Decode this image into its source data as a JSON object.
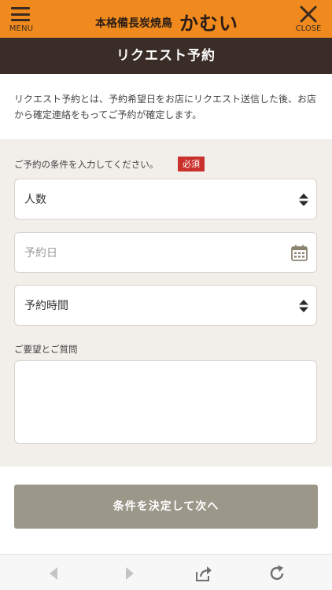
{
  "header": {
    "menu_label": "MENU",
    "close_label": "CLOSE",
    "brand_sub": "本格備長炭焼鳥",
    "brand_main": "かむい",
    "accent_color": "#f08a1e"
  },
  "page": {
    "title": "リクエスト予約",
    "intro": "リクエスト予約とは、予約希望日をお店にリクエスト送信した後、お店から確定連絡をもってご予約が確定します。"
  },
  "form": {
    "conditions_label": "ご予約の条件を入力してください。",
    "required_badge": "必須",
    "people_select": {
      "value": "人数",
      "icon": "sort-arrows-icon"
    },
    "date_input": {
      "placeholder": "予約日",
      "icon": "calendar-icon"
    },
    "time_select": {
      "value": "予約時間",
      "icon": "sort-arrows-icon"
    },
    "notes_label": "ご要望とご質問",
    "notes_value": "",
    "submit_label": "条件を決定して次へ"
  },
  "browser_toolbar": {
    "icons": [
      "back-arrow-icon",
      "forward-arrow-icon",
      "share-icon",
      "reload-icon"
    ]
  }
}
